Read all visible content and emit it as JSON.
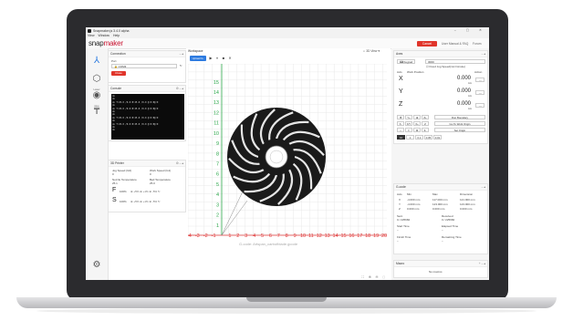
{
  "window": {
    "title": "Snapmaker.js 3.4.0 alpha",
    "controls": "–  ▢  ✕"
  },
  "menu": [
    "View",
    "Window",
    "Help"
  ],
  "brand": {
    "text_a": "snap",
    "text_b": "maker"
  },
  "topnav": {
    "cancel": "Cancel",
    "user": "User Manual & FAQ",
    "forum": "Forum"
  },
  "rail": {
    "label": "Cnc"
  },
  "connection": {
    "title": "Connection",
    "port_label": "Port",
    "port_value": "COM3",
    "close_label": "Close"
  },
  "console": {
    "title": "Console",
    "lines": [
      "ok",
      "ok",
      "ok T:25.0 /0.0 B:25.0 /0.0 @:0 B@:0",
      "ok",
      "ok T:25.0 /0.0 B:25.0 /0.0 @:0 B@:0",
      "ok",
      "ok",
      "ok T:25.0 /0.0 B:25.0 /0.0 @:0 B@:0",
      "ok",
      "ok T:25.0 /0.0 B:25.0 /0.0 @:0 B@:0",
      "ok",
      "ok"
    ]
  },
  "printer": {
    "title": "3D Printer",
    "jog_speed_g0": "Jog Speed (G0)",
    "jog_speed_g1": "Work Speed (G1)",
    "nozzle_temp": "Nozzle Temperature",
    "bed_temp": "Bed Temperature",
    "g0_value": "0",
    "g1_value": "0",
    "nozzle_value": "25.1",
    "bed_value": "25.0",
    "f_letter": "F",
    "s_letter": "S",
    "f_percent": "100%",
    "s_percent": "100%"
  },
  "workspace": {
    "title": "Workspace",
    "upload_label": "Upload G-code",
    "gcode_caption": "G-code: Artspan_carbofblade.gcode",
    "view_label": "3D View",
    "x_ticks": [
      "-4",
      "-3",
      "-2",
      "-1",
      "1",
      "2",
      "3",
      "4",
      "5",
      "6",
      "7",
      "8",
      "9",
      "10",
      "11",
      "12",
      "13",
      "14",
      "15",
      "16",
      "17",
      "18",
      "19",
      "20"
    ],
    "y_ticks": [
      "15",
      "14",
      "13",
      "12",
      "11",
      "10",
      "9",
      "8",
      "7",
      "6",
      "5",
      "4",
      "3",
      "2",
      "1"
    ],
    "footer_controls": "⛶ ⊕ ⊖ ⬚"
  },
  "axes": {
    "title": "Axes",
    "keypad_label": "Keypad",
    "jog_speed_label": "3000",
    "fixed_jog": "Fixed Jog Speed(mm/minute)",
    "col_axis": "Axis",
    "col_work_position": "Work Position",
    "col_action": "Action",
    "x_letter": "X",
    "y_letter": "Y",
    "z_letter": "Z",
    "x_value": "0.000",
    "y_value": "0.000",
    "z_value": "0.000",
    "unit": "mm",
    "run_boundary": "Run Boundary",
    "go_to_work_origin": "Go To Work Origin",
    "set_origin": "Set Origin",
    "step_values": [
      "10",
      "1",
      "0.1",
      "0.05",
      "0.01"
    ]
  },
  "gcode": {
    "title": "G-code",
    "headers": [
      "Axis",
      "Min",
      "Max",
      "Dimension"
    ],
    "rows": [
      [
        "X",
        "-4.000 mm",
        "117.000 mm",
        "121.000 mm"
      ],
      [
        "Y",
        "-4.000 mm",
        "123.000 mm",
        "123.000 mm"
      ],
      [
        "Z",
        "0.000 mm",
        "0.000 mm",
        "0.000 mm"
      ]
    ],
    "sent_label": "Sent",
    "sent_value": "0 / 225682",
    "received_label": "Received",
    "received_value": "0 / 225682",
    "start_time_label": "Start Time",
    "start_time_value": "–",
    "elapsed_label": "Elapsed Time",
    "elapsed_value": "–",
    "finish_label": "Finish Time",
    "finish_value": "–",
    "remaining_label": "Remaining Time",
    "remaining_value": "–"
  },
  "marlin": {
    "title": "Macro",
    "no_macros": "No macros"
  }
}
